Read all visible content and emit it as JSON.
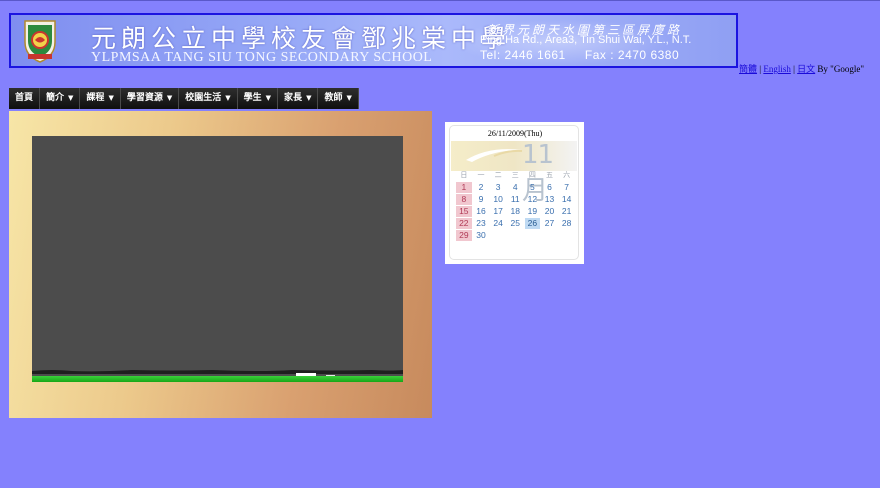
{
  "header": {
    "title_cn": "元朗公立中學校友會鄧兆棠中學",
    "title_en": "YLPMSAA TANG SIU TONG SECONDARY SCHOOL",
    "address_cn": "新界元朗天水圍第三區屏廈路",
    "address_en": "Ping Ha Rd., Area3, Tin Shui Wai, Y.L., N.T.",
    "phone": "Tel: 2446 1661     Fax : 2470 6380",
    "crest_icon": "school-crest-icon"
  },
  "language": {
    "simplified": "簡體",
    "sep1": " | ",
    "english": "English",
    "sep2": " | ",
    "japanese": "日文",
    "by": " By \"Google\""
  },
  "nav": {
    "items": [
      {
        "label": "首頁",
        "has_caret": false
      },
      {
        "label": "簡介",
        "has_caret": true
      },
      {
        "label": "課程",
        "has_caret": true
      },
      {
        "label": "學習資源",
        "has_caret": true
      },
      {
        "label": "校園生活",
        "has_caret": true
      },
      {
        "label": "學生",
        "has_caret": true
      },
      {
        "label": "家長",
        "has_caret": true
      },
      {
        "label": "教師",
        "has_caret": true
      }
    ],
    "caret": "▼"
  },
  "calendar": {
    "date": "26/11/2009(Thu)",
    "month": "11月",
    "weekdays": [
      "日",
      "一",
      "二",
      "三",
      "四",
      "五",
      "六"
    ],
    "weeks": [
      [
        "1",
        "2",
        "3",
        "4",
        "5",
        "6",
        "7"
      ],
      [
        "8",
        "9",
        "10",
        "11",
        "12",
        "13",
        "14"
      ],
      [
        "15",
        "16",
        "17",
        "18",
        "19",
        "20",
        "21"
      ],
      [
        "22",
        "23",
        "24",
        "25",
        "26",
        "27",
        "28"
      ],
      [
        "29",
        "30",
        "",
        "",
        "",
        "",
        ""
      ]
    ],
    "today": "26"
  },
  "colors": {
    "page_bg": "#8481fd",
    "banner_border": "#1b14e0",
    "nav_bg": "#1c1c1c",
    "link": "#1a0bd9"
  }
}
